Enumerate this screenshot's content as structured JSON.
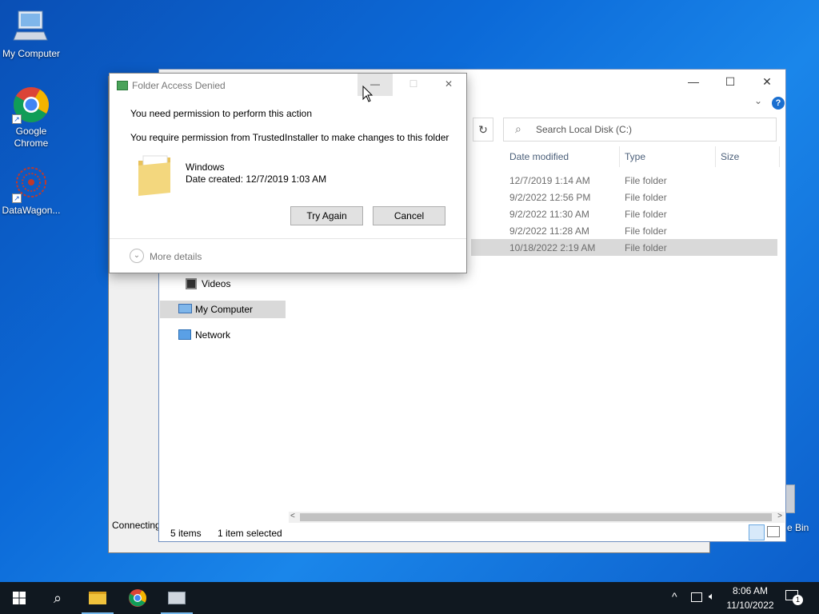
{
  "desktop": {
    "icons": [
      {
        "label": "My Computer",
        "icon": "computer-icon"
      },
      {
        "label": "Google Chrome",
        "icon": "chrome-icon"
      },
      {
        "label": "DataWagon...",
        "icon": "datawagon-icon"
      },
      {
        "label": "e Bin",
        "icon": "recycle-bin-icon"
      }
    ]
  },
  "back_window": {
    "status": "Connecting"
  },
  "explorer": {
    "search_placeholder": "Search Local Disk (C:)",
    "columns": [
      "Date modified",
      "Type",
      "Size"
    ],
    "rows": [
      {
        "date": "12/7/2019 1:14 AM",
        "type": "File folder"
      },
      {
        "date": "9/2/2022 12:56 PM",
        "type": "File folder"
      },
      {
        "date": "9/2/2022 11:30 AM",
        "type": "File folder"
      },
      {
        "date": "9/2/2022 11:28 AM",
        "type": "File folder"
      },
      {
        "date": "10/18/2022 2:19 AM",
        "type": "File folder",
        "selected": true
      }
    ],
    "nav": [
      {
        "label": "Videos",
        "icon": "videos-icon"
      },
      {
        "label": "My Computer",
        "icon": "computer-icon",
        "selected": true
      },
      {
        "label": "Network",
        "icon": "network-icon"
      }
    ],
    "status_items": "5 items",
    "status_selected": "1 item selected"
  },
  "dialog": {
    "title": "Folder Access Denied",
    "heading": "You need permission to perform this action",
    "message": "You require permission from TrustedInstaller to make changes to this folder",
    "folder_name": "Windows",
    "folder_date": "Date created: 12/7/2019 1:03 AM",
    "try_again": "Try Again",
    "cancel": "Cancel",
    "more_details": "More details"
  },
  "taskbar": {
    "time": "8:06 AM",
    "date": "11/10/2022",
    "notification_count": "1"
  },
  "colors": {
    "accent": "#0078d7",
    "selection": "#cce4f7",
    "taskbar": "#101820"
  }
}
